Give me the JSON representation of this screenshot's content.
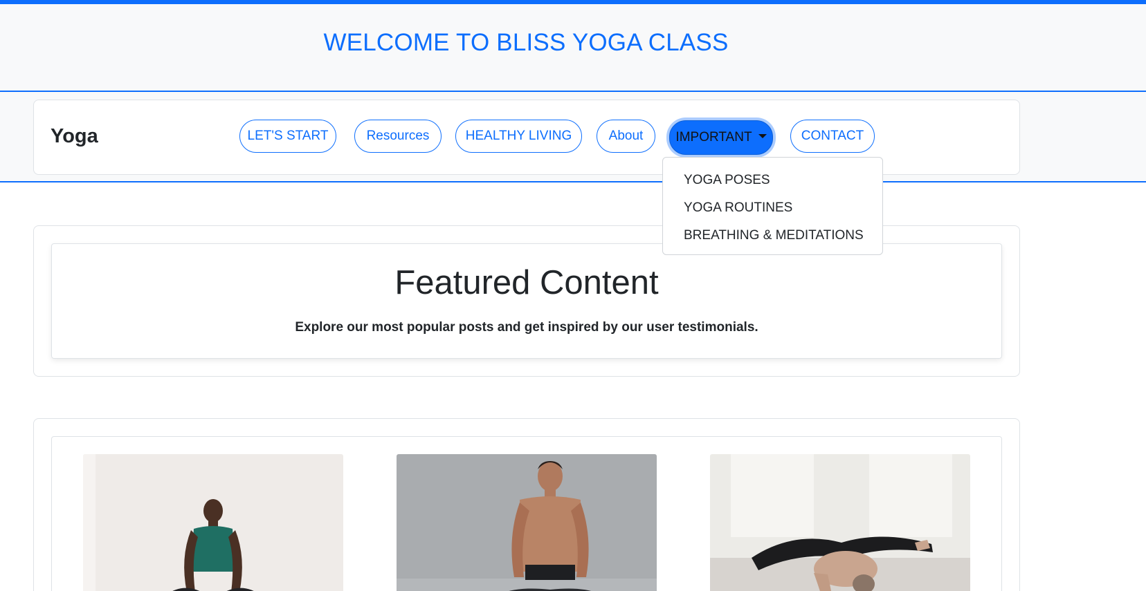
{
  "header": {
    "title": "WELCOME TO BLISS YOGA CLASS"
  },
  "navbar": {
    "brand": "Yoga",
    "links": [
      {
        "label": "LET'S START"
      },
      {
        "label": "Resources"
      },
      {
        "label": "HEALTHY LIVING"
      },
      {
        "label": "About"
      },
      {
        "label": "IMPORTANT",
        "active": true,
        "has_dropdown": true
      },
      {
        "label": "CONTACT"
      }
    ]
  },
  "dropdown": {
    "items": [
      {
        "label": "YOGA POSES"
      },
      {
        "label": "YOGA ROUTINES"
      },
      {
        "label": "BREATHING & MEDITATIONS"
      }
    ]
  },
  "featured": {
    "title": "Featured Content",
    "subtitle": "Explore our most popular posts and get inspired by our user testimonials."
  },
  "colors": {
    "accent": "#0d6efd",
    "header_bg": "#f8f9fa",
    "text": "#212529"
  }
}
